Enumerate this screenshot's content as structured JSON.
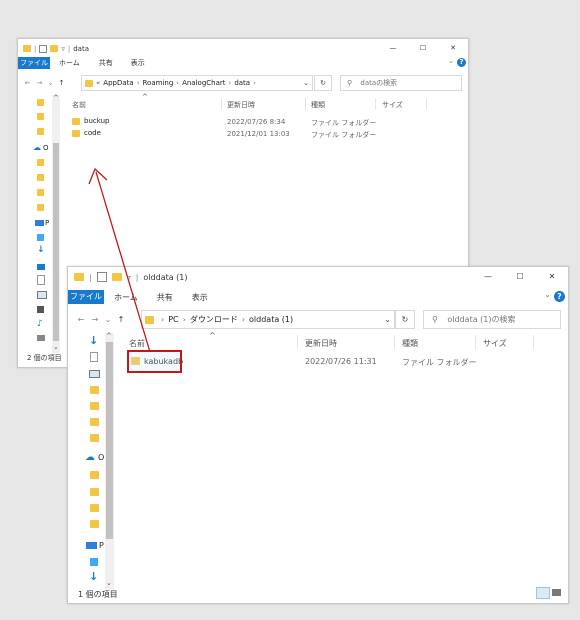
{
  "colors": {
    "accent": "#1979ca",
    "folder": "#f4c542",
    "highlight": "#c01818"
  },
  "window1": {
    "title": "data",
    "ribbon_tabs": [
      "ファイル",
      "ホーム",
      "共有",
      "表示"
    ],
    "path": [
      "«",
      "AppData",
      "Roaming",
      "AnalogChart",
      "data"
    ],
    "search_placeholder": "dataの検索",
    "columns": [
      "名前",
      "更新日時",
      "種類",
      "サイズ"
    ],
    "rows": [
      {
        "name": "buckup",
        "date": "2022/07/26 8:34",
        "type": "ファイル フォルダー"
      },
      {
        "name": "code",
        "date": "2021/12/01 13:03",
        "type": "ファイル フォルダー"
      }
    ],
    "nav_labels": {
      "onedrive": "O",
      "pc": "P"
    },
    "status": "2 個の項目"
  },
  "window2": {
    "title": "olddata (1)",
    "ribbon_tabs": [
      "ファイル",
      "ホーム",
      "共有",
      "表示"
    ],
    "path": [
      "PC",
      "ダウンロード",
      "olddata (1)"
    ],
    "search_placeholder": "olddata (1)の検索",
    "columns": [
      "名前",
      "更新日時",
      "種類",
      "サイズ"
    ],
    "rows": [
      {
        "name": "kabukadb",
        "date": "2022/07/26 11:31",
        "type": "ファイル フォルダー"
      }
    ],
    "nav_labels": {
      "onedrive": "O",
      "pc": "P"
    },
    "status": "1 個の項目"
  },
  "icons": {
    "minimize": "—",
    "maximize": "☐",
    "close": "✕",
    "help": "?",
    "back": "←",
    "forward": "→",
    "recent": "⌄",
    "up": "↑",
    "refresh": "↻",
    "search": "⚲",
    "chevron": "⌄",
    "sort": "^",
    "separator": "›"
  }
}
